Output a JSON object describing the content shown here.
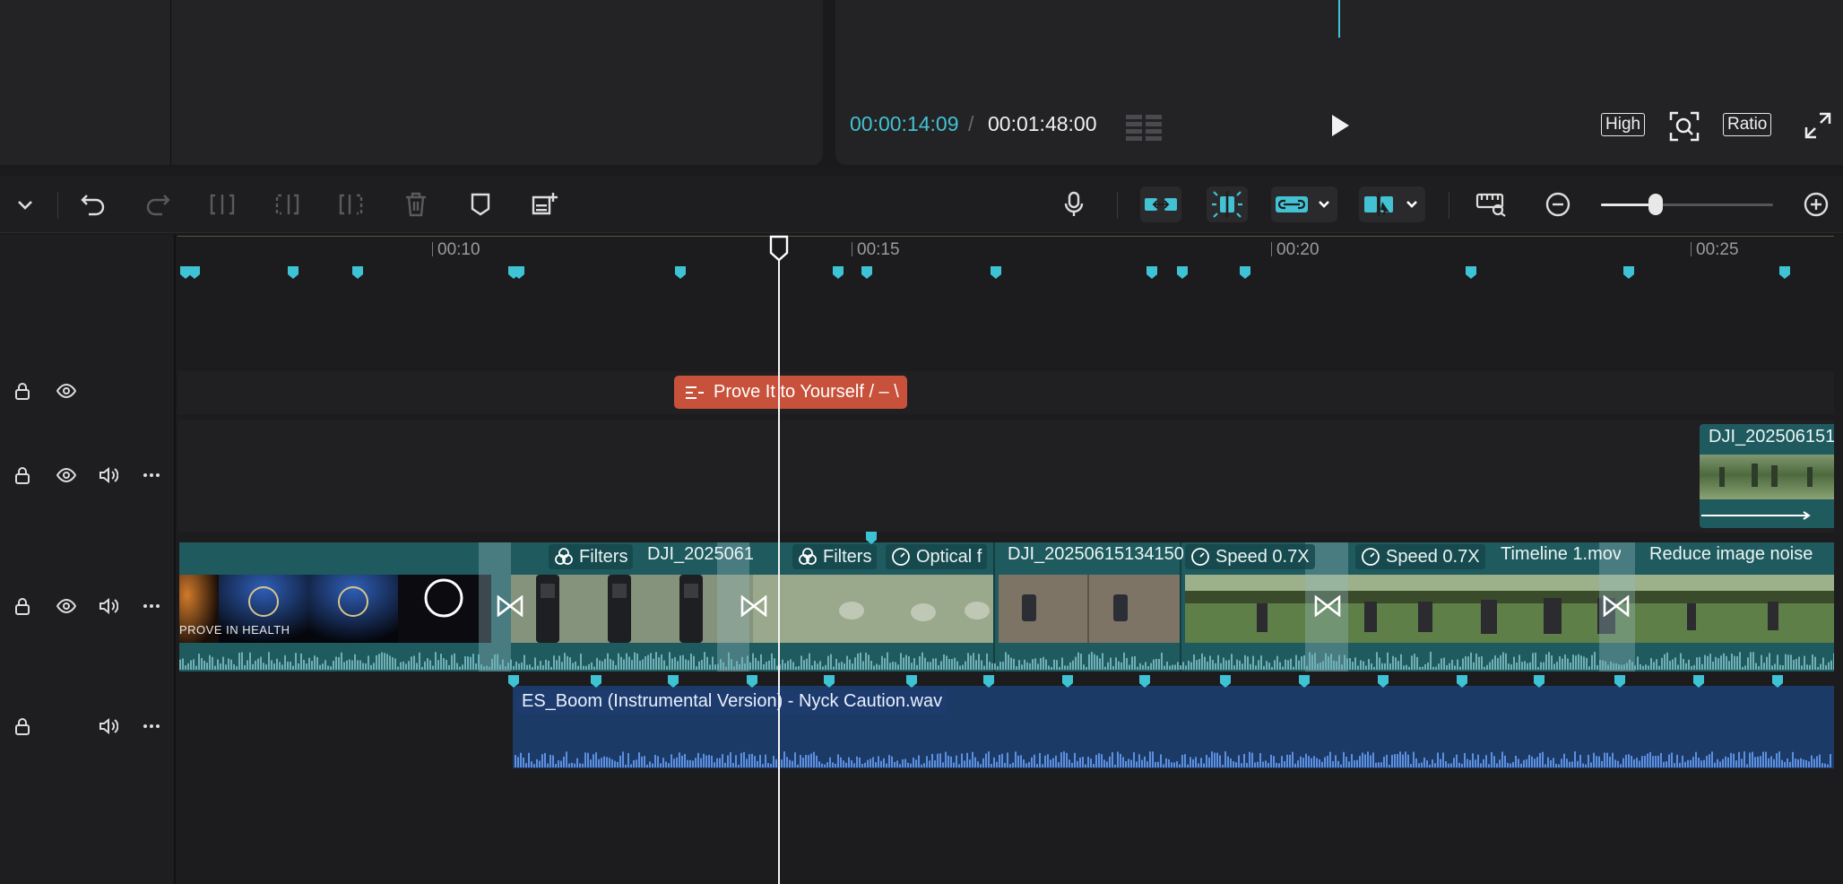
{
  "player": {
    "current_time": "00:00:14:09",
    "separator": "/",
    "total_time": "00:01:48:00",
    "quality_label": "High",
    "ratio_label": "Ratio"
  },
  "toolbar": {
    "icons": [
      "chevron-down-icon",
      "undo-icon",
      "redo-icon",
      "split-icon",
      "split-left-icon",
      "split-right-icon",
      "delete-icon",
      "marker-icon",
      "add-note-icon",
      "microphone-icon",
      "main-track-magnet-icon",
      "auto-snap-icon",
      "link-icon",
      "preview-axis-icon",
      "fit-timeline-icon",
      "zoom-out-icon",
      "zoom-in-icon"
    ],
    "zoom_level": 0.32
  },
  "ruler": {
    "labels": [
      "00:10",
      "00:15",
      "00:20",
      "00:25"
    ]
  },
  "tracks": {
    "text_clip_label": "Prove It to Yourself  / – \\",
    "overlay_clip_label": "DJI_202506151",
    "video_clips": {
      "filters_1": "Filters",
      "dji_1": "DJI_2025061",
      "filters_2": "Filters",
      "optical": "Optical f",
      "dji_2": "DJI_20250615134150",
      "speed_1": "Speed 0.7X",
      "speed_2": "Speed 0.7X",
      "timeline": "Timeline 1.mov",
      "reduce": "Reduce image noise",
      "intro_text": "PROVE IN HEALTH"
    },
    "audio_clip_label": "ES_Boom (Instrumental Version) - Nyck Caution.wav"
  },
  "colors": {
    "accent": "#43c2d3",
    "text_clip": "#c7513a",
    "video_track": "#1f5a5e",
    "audio_track": "#1b3a66"
  }
}
